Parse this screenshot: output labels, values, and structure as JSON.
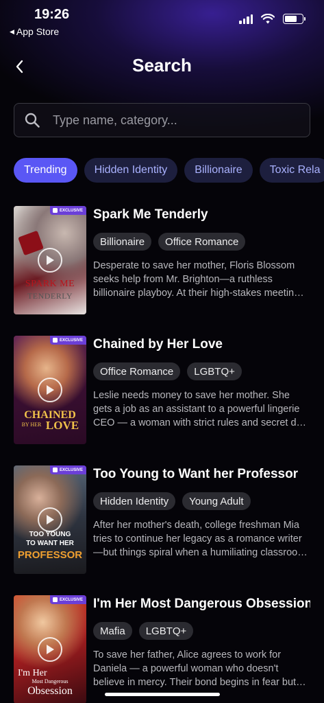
{
  "status_bar": {
    "time": "19:26",
    "back_app": "App Store"
  },
  "header": {
    "title": "Search"
  },
  "search": {
    "placeholder": "Type name, category..."
  },
  "chips": [
    "Trending",
    "Hidden Identity",
    "Billionaire",
    "Toxic Rela"
  ],
  "colors": {
    "accent": "#5a57f5",
    "chip_bg": "#1d1f3e",
    "chip_text": "#aab2ff",
    "tag_bg": "#2b2b31",
    "exclusive_badge": "#6b3fd8"
  },
  "badge_label": "EXCLUSIVE",
  "items": [
    {
      "title": "Spark Me Tenderly",
      "tags": [
        "Billionaire",
        "Office Romance"
      ],
      "desc": [
        "Desperate to save her mother, Floris Blossom",
        "seeks help from Mr. Brighton—a ruthless",
        "billionaire playboy. At their high-stakes meetin…"
      ],
      "cover_text": [
        "SPARK ME",
        "TENDERLY"
      ]
    },
    {
      "title": "Chained by Her Love",
      "tags": [
        "Office Romance",
        "LGBTQ+"
      ],
      "desc": [
        "Leslie needs money to save her mother. She",
        "gets a job as an assistant to a powerful lingerie",
        "CEO — a woman with strict rules and secret d…"
      ],
      "cover_text": [
        "CHAINED",
        "BY HER",
        "LOVE"
      ]
    },
    {
      "title": "Too Young to Want her Professor",
      "tags": [
        "Hidden Identity",
        "Young Adult"
      ],
      "desc": [
        "After her mother's death, college freshman Mia",
        "tries to continue her legacy as a romance writer",
        "—but things spiral when a humiliating classroo…"
      ],
      "cover_text": [
        "TOO YOUNG",
        "TO WANT HER",
        "PROFESSOR"
      ]
    },
    {
      "title": "I'm Her Most Dangerous Obsession",
      "tags": [
        "Mafia",
        "LGBTQ+"
      ],
      "desc": [
        "To save her father, Alice agrees to work for",
        "Daniela — a powerful woman who doesn't",
        "believe in mercy. Their bond begins in fear but…"
      ],
      "cover_text": [
        "I'm Her",
        "Most Dangerous",
        "Obsession"
      ]
    }
  ]
}
